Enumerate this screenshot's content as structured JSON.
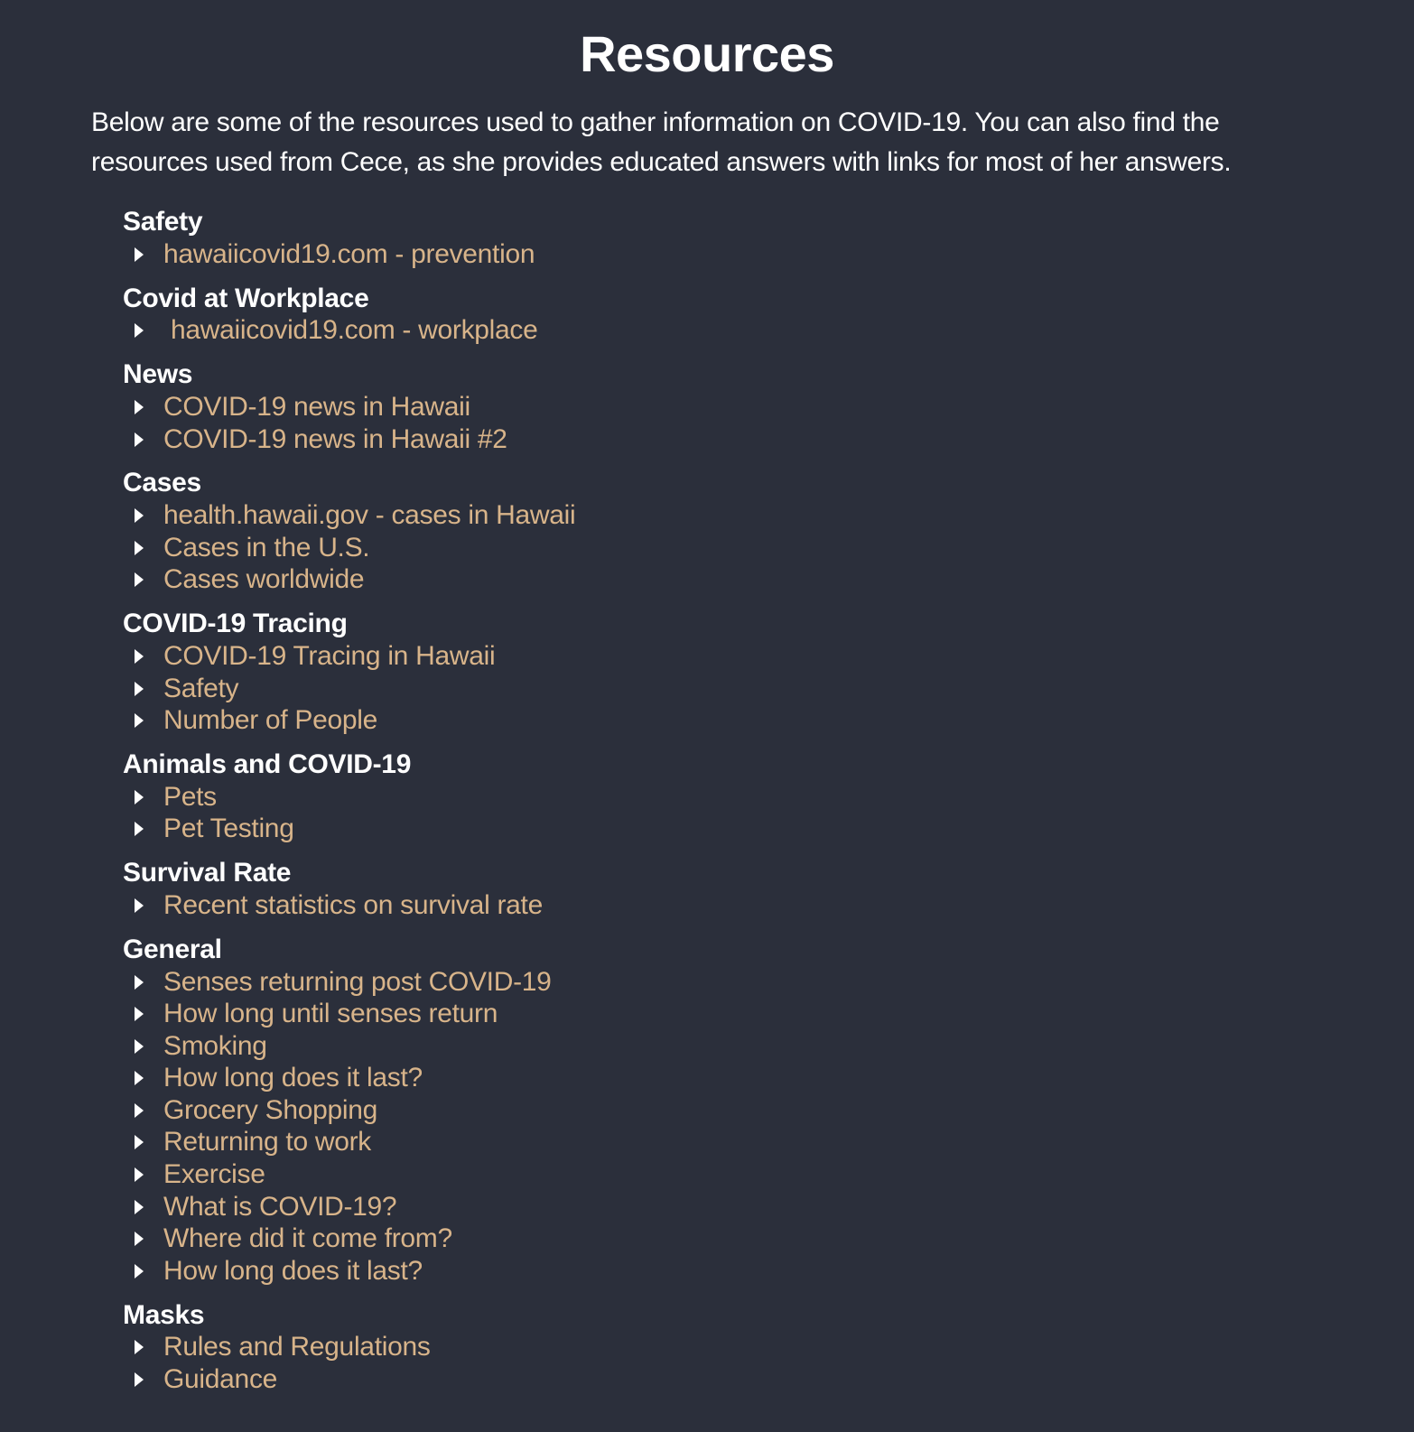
{
  "page": {
    "title": "Resources",
    "intro": "Below are some of the resources used to gather information on COVID-19. You can also find the resources used from Cece, as she provides educated answers with links for most of her answers."
  },
  "colors": {
    "background": "#2b2f3b",
    "text": "#ffffff",
    "link": "#d8b48a"
  },
  "sections": [
    {
      "title": "Safety",
      "links": [
        "hawaiicovid19.com - prevention"
      ]
    },
    {
      "title": "Covid at Workplace",
      "links": [
        " hawaiicovid19.com - workplace"
      ]
    },
    {
      "title": "News",
      "links": [
        "COVID-19 news in Hawaii",
        "COVID-19 news in Hawaii #2"
      ]
    },
    {
      "title": "Cases",
      "links": [
        "health.hawaii.gov - cases in Hawaii",
        "Cases in the U.S.",
        "Cases worldwide"
      ]
    },
    {
      "title": "COVID-19 Tracing",
      "links": [
        "COVID-19 Tracing in Hawaii",
        "Safety",
        "Number of People"
      ]
    },
    {
      "title": "Animals and COVID-19",
      "links": [
        "Pets",
        "Pet Testing"
      ]
    },
    {
      "title": "Survival Rate",
      "links": [
        "Recent statistics on survival rate"
      ]
    },
    {
      "title": "General",
      "links": [
        "Senses returning post COVID-19",
        "How long until senses return",
        "Smoking",
        "How long does it last?",
        "Grocery Shopping",
        "Returning to work",
        "Exercise",
        "What is COVID-19?",
        "Where did it come from?",
        "How long does it last?"
      ]
    },
    {
      "title": "Masks",
      "links": [
        "Rules and Regulations",
        "Guidance"
      ]
    }
  ]
}
